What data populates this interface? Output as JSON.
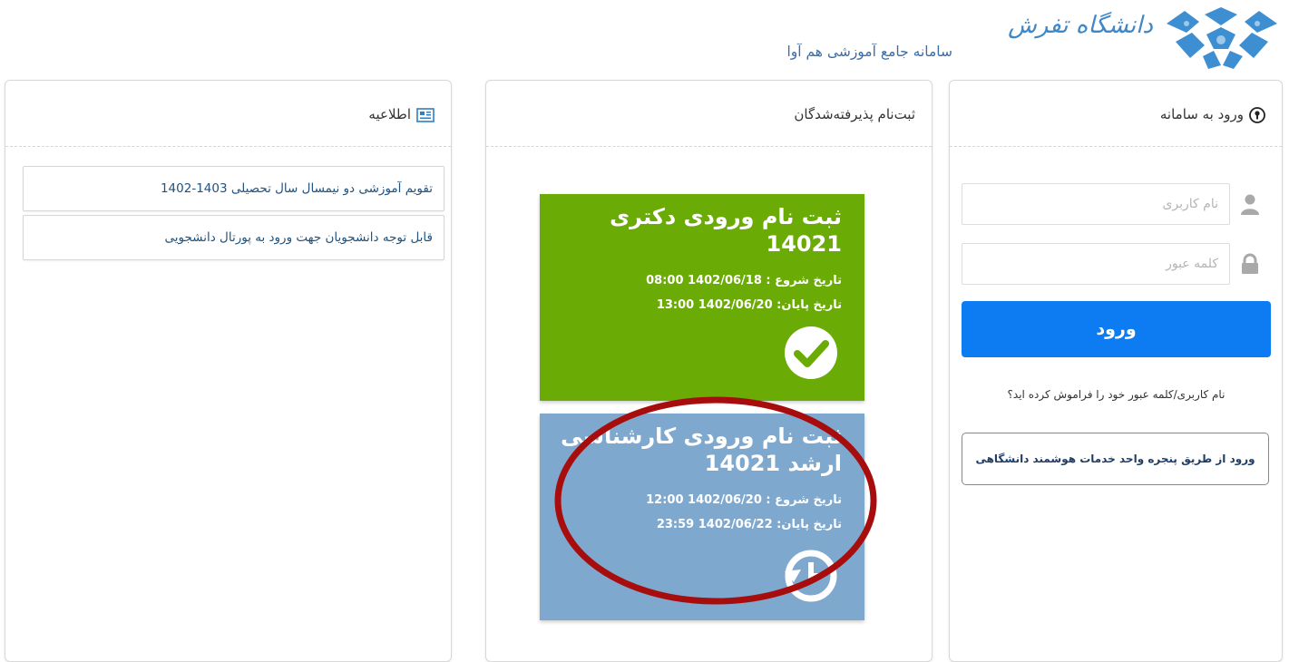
{
  "header": {
    "logo_script": "دانشگاه تفرش",
    "system_title": "سامانه جامع آموزشی هم آوا"
  },
  "login_panel": {
    "title": "ورود به سامانه",
    "username_placeholder": "نام کاربری",
    "password_placeholder": "کلمه عبور",
    "login_button": "ورود",
    "forgot_link": "نام کاربری/کلمه عبور خود را فراموش کرده اید؟",
    "sso_button": "ورود از طریق پنجره واحد خدمات هوشمند دانشگاهی"
  },
  "registration_panel": {
    "title": "ثبت‌نام پذیرفته‌شدگان",
    "cards": [
      {
        "title": "ثبت نام ورودی دکتری 14021",
        "start": "تاریخ شروع : 1402/06/18 08:00",
        "end": "تاریخ پایان: 1402/06/20 13:00",
        "status_icon": "check-circle-icon",
        "color": "#6aab05"
      },
      {
        "title": "ثبت نام ورودی کارشناسی ارشد 14021",
        "start": "تاریخ شروع : 1402/06/20 12:00",
        "end": "تاریخ پایان: 1402/06/22 23:59",
        "status_icon": "history-icon",
        "color": "#7fa8cf"
      }
    ]
  },
  "news_panel": {
    "title": "اطلاعیه",
    "items": [
      "تقویم آموزشی دو نیمسال سال تحصیلی 1403-1402",
      "قابل توجه دانشجویان جهت ورود به پورتال دانشجویی"
    ]
  },
  "colors": {
    "primary_button": "#0d7bf2",
    "annotation_ellipse": "#a80d0d"
  }
}
